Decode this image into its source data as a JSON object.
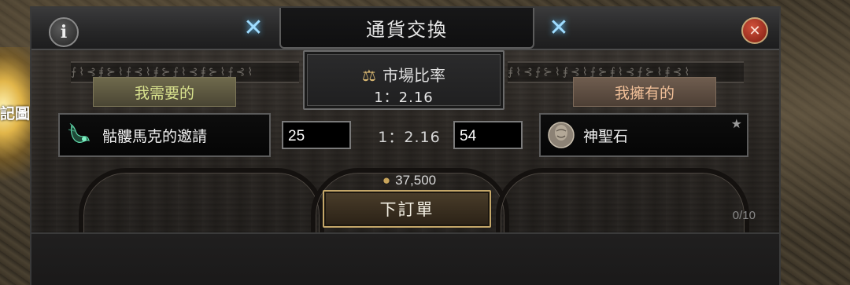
{
  "background": {
    "cut_text": "記圖鑑"
  },
  "window": {
    "title": "通貨交換",
    "info_label": "i",
    "close_label": "✕"
  },
  "market": {
    "title": "市場比率",
    "rate": "1：2.16"
  },
  "need": {
    "tag": "我需要的",
    "item_name": "骷髏馬克的邀請",
    "quantity": "25"
  },
  "have": {
    "tag": "我擁有的",
    "item_name": "神聖石",
    "quantity": "54"
  },
  "exchange_rate": "1：2.16",
  "cost": "37,500",
  "order_button": "下訂單",
  "order_count": "0/10",
  "colors": {
    "need_tag": "#d9e28e",
    "have_tag": "#f0bf98",
    "button_border": "#c4a769"
  }
}
